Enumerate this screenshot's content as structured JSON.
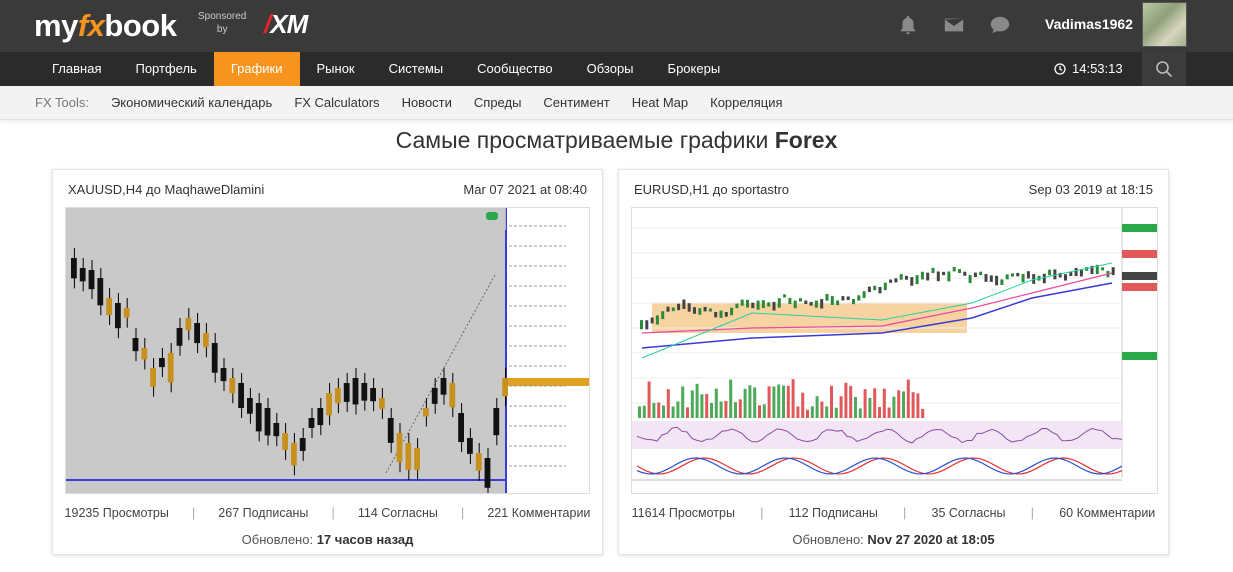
{
  "header": {
    "logo_left": "my",
    "logo_fx": "fx",
    "logo_right": "book",
    "sponsored_line1": "Sponsored",
    "sponsored_line2": "by",
    "sponsor_brand": "XM",
    "username": "Vadimas1962",
    "icons": [
      "bell-icon",
      "envelope-icon",
      "chat-bubble-icon"
    ]
  },
  "nav": {
    "items": [
      "Главная",
      "Портфель",
      "Графики",
      "Рынок",
      "Системы",
      "Сообщество",
      "Обзоры",
      "Брокеры"
    ],
    "active_index": 2,
    "clock": "14:53:13"
  },
  "tools": {
    "label": "FX Tools:",
    "items": [
      "Экономический календарь",
      "FX Calculators",
      "Новости",
      "Спреды",
      "Сентимент",
      "Heat Map",
      "Корреляция"
    ]
  },
  "page": {
    "title_prefix": "Самые просматриваемые графики",
    "title_bold": "Forex"
  },
  "cards": [
    {
      "pair": "XAUUSD,H4",
      "by": "до",
      "author": "MaqhaweDlamini",
      "date": "Mar 07 2021 at 08:40",
      "views": "19235 Просмотры",
      "subscribers": "267 Подписаны",
      "agrees": "114 Согласны",
      "comments": "221 Комментарии",
      "updated_label": "Обновлено:",
      "updated_value": "17 часов назад"
    },
    {
      "pair": "EURUSD,H1",
      "by": "до",
      "author": "sportastro",
      "date": "Sep 03 2019 at 18:15",
      "views": "11614 Просмотры",
      "subscribers": "112 Подписаны",
      "agrees": "35 Согласны",
      "comments": "60 Комментарии",
      "updated_label": "Обновлено:",
      "updated_value": "Nov 27 2020 at 18:05"
    }
  ],
  "colors": {
    "accent": "#f7941d",
    "topbar": "#3a3a3a",
    "navbar": "#2b2b2b"
  }
}
